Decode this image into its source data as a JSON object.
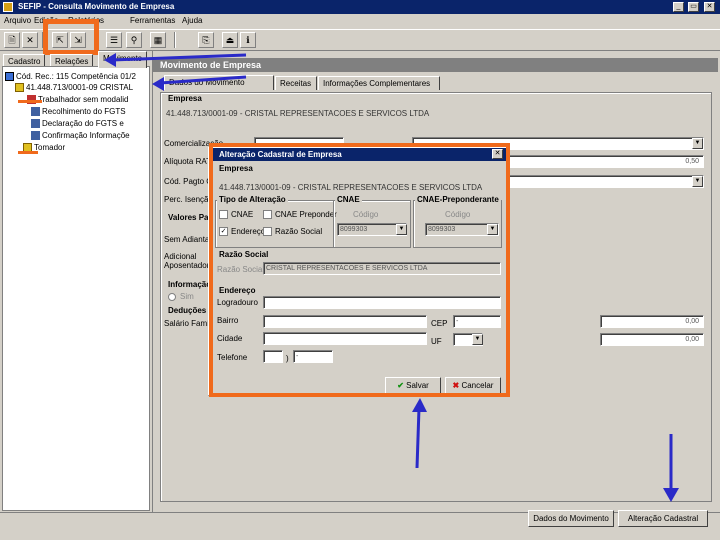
{
  "window": {
    "title": "SEFIP - Consulta Movimento de Empresa",
    "min_label": "_",
    "restore_label": "▭",
    "close_label": "✕"
  },
  "menu": [
    "Arquivo",
    "Edição",
    "Relatórios",
    "Ferramentas",
    "Ajuda"
  ],
  "toolbar": {
    "buttons": [
      "🗎",
      "✕",
      "⇱",
      "⇲",
      "☰",
      "⚲",
      "▦",
      "⎘",
      "⏏",
      "ℹ"
    ]
  },
  "left_tabs": [
    "Cadastro",
    "Relações",
    "Movimento"
  ],
  "tree": {
    "root": "Cód. Rec.: 115 Competência 01/2",
    "company": "41.448.713/0001-09 CRISTAL",
    "items": [
      "Trabalhador sem modalid",
      "Recolhimento do FGTS",
      "Declaração do FGTS e",
      "Confirmação Informaçõe"
    ],
    "tomador": "Tomador"
  },
  "main": {
    "section_title": "Movimento de Empresa",
    "tabs": [
      "Dados do Movimento",
      "Receitas",
      "Informações Complementares"
    ],
    "empresa_group": "Empresa",
    "empresa_value": "41.448.713/0001-09 - CRISTAL REPRESENTACOES E SERVICOS LTDA",
    "labels": {
      "comercializacao": "Comercialização",
      "aliquota": "Alíquota RAT",
      "cod_pagto": "Cód. Pagto GPS",
      "perc_isencao": "Perc. Isenção Filantropia",
      "valores_group": "Valores Pagos",
      "sem_adiant": "Sem Adiantamento",
      "adicional": "Adicional Aposentadoria",
      "informacao_group": "Informação",
      "sim": "Sim",
      "deducoes_group": "Deduções",
      "salario_fam": "Salário Família"
    },
    "values": {
      "aliquota": "0,50",
      "salario_fam_1": "0,00",
      "salario_fam_2": "0,00"
    },
    "bottom_buttons": [
      "Dados do Movimento",
      "Alteração Cadastral"
    ]
  },
  "dialog": {
    "title": "Alteração Cadastral de Empresa",
    "close_label": "✕",
    "empresa_group": "Empresa",
    "empresa_value": "41.448.713/0001-09 - CRISTAL REPRESENTACOES E SERVICOS LTDA",
    "tipo_group": "Tipo de Alteração",
    "tipo_options": [
      {
        "label": "CNAE",
        "checked": false
      },
      {
        "label": "CNAE Preponder",
        "checked": false
      },
      {
        "label": "Endereço",
        "checked": true
      },
      {
        "label": "Razão Social",
        "checked": false
      }
    ],
    "cnae_group": "CNAE",
    "cnae_header": "Código",
    "cnae_value": "8099303",
    "cnae_prep_group": "CNAE-Preponderante",
    "cnae_prep_header": "Código",
    "cnae_prep_value": "8099303",
    "razao_group": "Razão Social",
    "razao_label": "Razão Social",
    "razao_value": "CRISTAL REPRESENTACOES E SERVICOS LTDA",
    "endereco_group": "Endereço",
    "logradouro_label": "Logradouro",
    "bairro_label": "Bairro",
    "cidade_label": "Cidade",
    "telefone_label": "Telefone",
    "cep_label": "CEP",
    "uf_label": "UF",
    "cep_value": "-",
    "telefone_sep": ")",
    "telefone_dash": "-",
    "save_label": "Salvar",
    "cancel_label": "Cancelar"
  },
  "colors": {
    "highlight_border": "#f06a1c",
    "arrow": "#2a2ac8",
    "titlebar": "#0a246a"
  }
}
